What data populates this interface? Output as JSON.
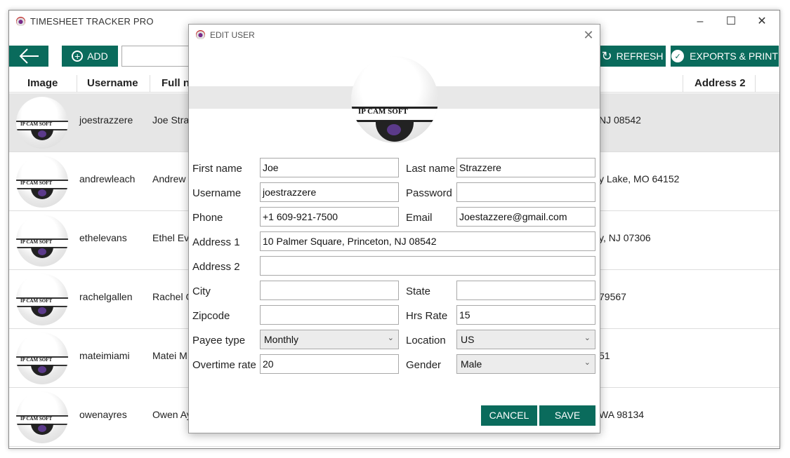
{
  "app": {
    "title": "TIMESHEET TRACKER PRO"
  },
  "toolbar": {
    "add_label": "ADD",
    "refresh_label": "REFRESH",
    "export_label": "EXPORTS & PRINT"
  },
  "table": {
    "headers": [
      "Image",
      "Username",
      "Full n",
      "Address 2"
    ],
    "rows": [
      {
        "username": "joestrazzere",
        "fullname": "Joe Straz",
        "address": "NJ 08542",
        "logo_text": "IP CAM SOFT"
      },
      {
        "username": "andrewleach",
        "fullname": "Andrew",
        "address": "y Lake, MO 64152",
        "logo_text": "IP CAM SOFT"
      },
      {
        "username": "ethelevans",
        "fullname": "Ethel Eva",
        "address": "y, NJ 07306",
        "logo_text": "IP CAM SOFT"
      },
      {
        "username": "rachelgallen",
        "fullname": "Rachel G",
        "address": "79567",
        "logo_text": "IP CAM SOFT"
      },
      {
        "username": "mateimiami",
        "fullname": "Matei M",
        "address": "51",
        "logo_text": "IP CAM SOFT"
      },
      {
        "username": "owenayres",
        "fullname": "Owen Ay",
        "address": "WA 98134",
        "logo_text": "IP CAM SOFT"
      }
    ]
  },
  "dialog": {
    "title": "EDIT USER",
    "logo_text": "IP CAM SOFT",
    "fields": {
      "first_name": {
        "label": "First name",
        "value": "Joe"
      },
      "last_name": {
        "label": "Last name",
        "value": "Strazzere"
      },
      "username": {
        "label": "Username",
        "value": "joestrazzere"
      },
      "password": {
        "label": "Password",
        "value": ""
      },
      "phone": {
        "label": "Phone",
        "value": "+1 609-921-7500"
      },
      "email": {
        "label": "Email",
        "value": "Joestazzere@gmail.com"
      },
      "address1": {
        "label": "Address 1",
        "value": "10 Palmer Square, Princeton, NJ 08542"
      },
      "address2": {
        "label": "Address 2",
        "value": ""
      },
      "city": {
        "label": "City",
        "value": ""
      },
      "state": {
        "label": "State",
        "value": ""
      },
      "zipcode": {
        "label": "Zipcode",
        "value": ""
      },
      "hrs_rate": {
        "label": "Hrs Rate",
        "value": "15"
      },
      "payee_type": {
        "label": "Payee type",
        "value": "Monthly"
      },
      "location": {
        "label": "Location",
        "value": "US"
      },
      "overtime_rate": {
        "label": "Overtime rate",
        "value": "20"
      },
      "gender": {
        "label": "Gender",
        "value": "Male"
      }
    },
    "cancel_label": "CANCEL",
    "save_label": "SAVE"
  },
  "colors": {
    "accent": "#0a6b5c",
    "selected_row": "#e6e6e6"
  }
}
